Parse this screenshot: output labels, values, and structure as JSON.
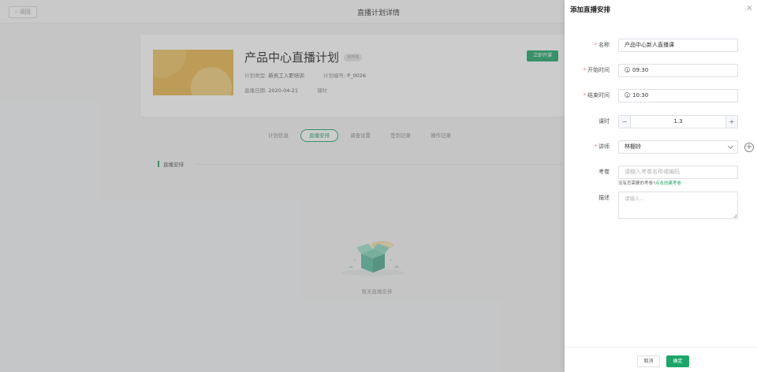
{
  "topbar": {
    "back_label": "返回",
    "title": "直播计划详情"
  },
  "plan": {
    "name": "产品中心直播计划",
    "status_badge": "未开课",
    "type_label": "计划类型:",
    "type_value": "新员工入职培训",
    "code_label": "计划编号:",
    "code_value": "P_0026",
    "date_label": "直播日期:",
    "date_value": "2020-04-21",
    "hours_label": "课时",
    "start_button": "立即开课"
  },
  "tabs": [
    {
      "label": "计划信息",
      "active": false
    },
    {
      "label": "直播安排",
      "active": true
    },
    {
      "label": "调查设置",
      "active": false
    },
    {
      "label": "签到记录",
      "active": false
    },
    {
      "label": "操作记录",
      "active": false
    }
  ],
  "section": {
    "title": "直播安排",
    "empty_text": "暂无直播安排"
  },
  "drawer": {
    "title": "添加直播安排",
    "fields": {
      "name": {
        "label": "名称",
        "required": true,
        "value": "产品中心新人直播课"
      },
      "start_time": {
        "label": "开始时间",
        "required": true,
        "value": "09:30"
      },
      "end_time": {
        "label": "结束时间",
        "required": true,
        "value": "10:30"
      },
      "hours": {
        "label": "课时",
        "required": false,
        "value": "1.3"
      },
      "lecturer": {
        "label": "讲师",
        "required": true,
        "value": "林棚铃"
      },
      "exam": {
        "label": "考卷",
        "required": false,
        "placeholder": "请输入考卷名称或编码"
      },
      "description": {
        "label": "描述",
        "required": false,
        "placeholder": "请输入..."
      }
    },
    "exam_hint": "没有您需要的考卷?",
    "exam_hint_link": "点击创建考卷",
    "cancel_label": "取消",
    "confirm_label": "确定"
  },
  "colors": {
    "accent": "#1ba768",
    "required": "#f56c6c",
    "cover": "#e7b64a"
  }
}
